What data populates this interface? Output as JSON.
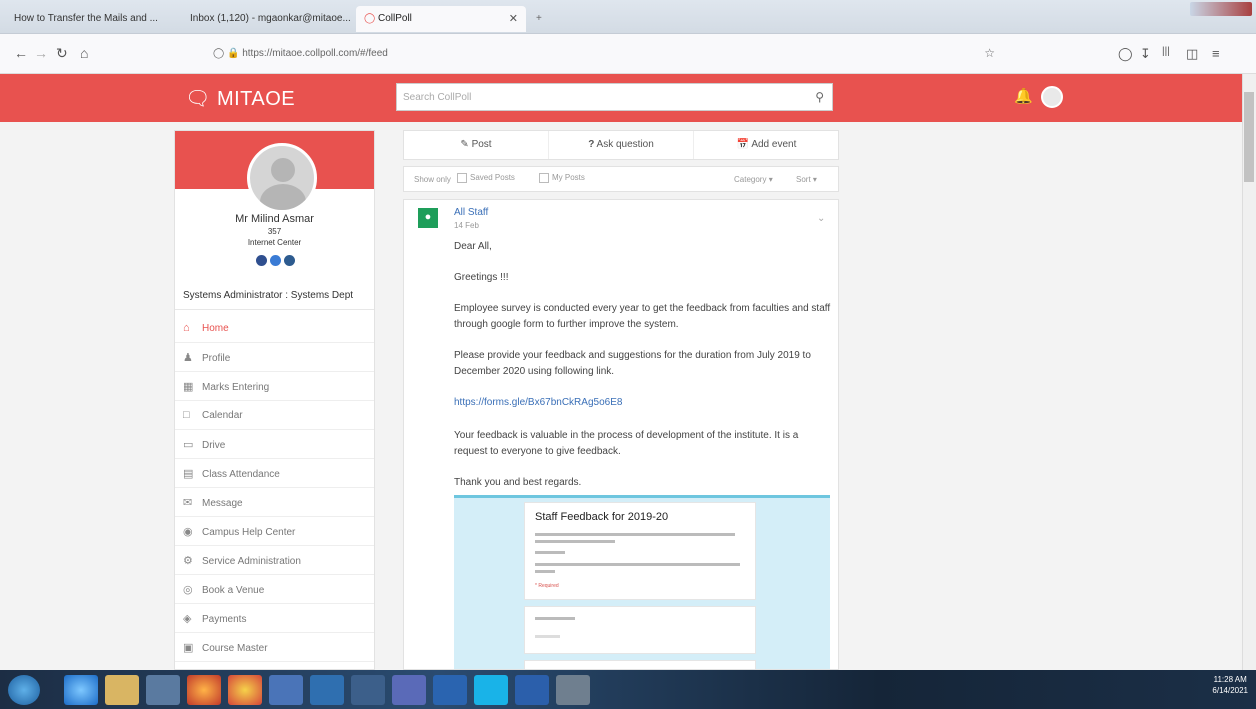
{
  "browser": {
    "tabs": [
      {
        "label": "How to Transfer the Mails and ..."
      },
      {
        "label": "Inbox (1,120) - mgaonkar@mitaoe..."
      },
      {
        "label": "CollPoll"
      }
    ],
    "url": "https://mitaoe.collpoll.com/#/feed"
  },
  "header": {
    "brand": "MITAOE",
    "search_placeholder": "Search CollPoll"
  },
  "profile": {
    "name": "Mr Milind Asmar",
    "id": "357",
    "department": "Internet Center",
    "role": "Systems Administrator : Systems Dept"
  },
  "menu": [
    {
      "label": "Home",
      "icon": "home-icon"
    },
    {
      "label": "Profile",
      "icon": "user-icon"
    },
    {
      "label": "Marks Entering",
      "icon": "marks-icon"
    },
    {
      "label": "Calendar",
      "icon": "calendar-icon"
    },
    {
      "label": "Drive",
      "icon": "folder-icon"
    },
    {
      "label": "Class Attendance",
      "icon": "attendance-icon"
    },
    {
      "label": "Message",
      "icon": "message-icon"
    },
    {
      "label": "Campus Help Center",
      "icon": "help-icon"
    },
    {
      "label": "Service Administration",
      "icon": "service-icon"
    },
    {
      "label": "Book a Venue",
      "icon": "location-icon"
    },
    {
      "label": "Payments",
      "icon": "payments-icon"
    },
    {
      "label": "Course Master",
      "icon": "course-icon"
    }
  ],
  "composer": {
    "post": "Post",
    "ask": "Ask question",
    "event": "Add event"
  },
  "filters": {
    "show_only": "Show only",
    "saved": "Saved Posts",
    "my": "My Posts",
    "category": "Category",
    "sort": "Sort"
  },
  "post": {
    "author": "All Staff",
    "date": "14 Feb",
    "paragraphs": [
      "Dear All,",
      "Greetings !!!",
      "Employee survey is conducted every year to get the feedback from faculties and staff through google form to further improve the system.",
      "Please provide your feedback and suggestions for the duration from July 2019 to December 2020 using following link.",
      "https://forms.gle/Bx67bnCkRAg5o6E8",
      "Your feedback is valuable in the process of development of the institute. It is a request to everyone to give feedback.",
      "Thank you and best regards."
    ],
    "form_title": "Staff Feedback for 2019-20"
  },
  "taskbar": {
    "time": "11:28 AM",
    "date": "6/14/2021"
  },
  "colors": {
    "brand": "#e8524f",
    "link": "#3a6fb7",
    "badge": "#1e9e5a"
  }
}
